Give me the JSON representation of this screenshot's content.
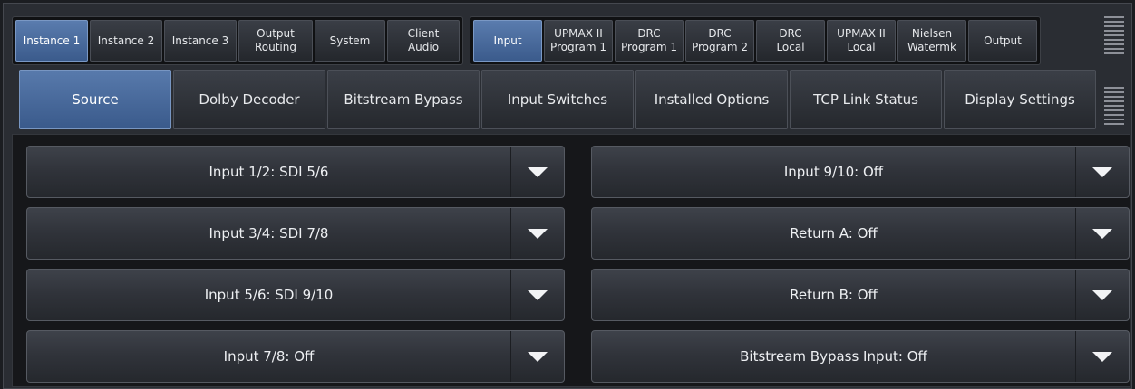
{
  "top_tabs_left": [
    {
      "label": "Instance 1",
      "active": true
    },
    {
      "label": "Instance 2",
      "active": false
    },
    {
      "label": "Instance 3",
      "active": false
    },
    {
      "label": "Output\nRouting",
      "active": false
    },
    {
      "label": "System",
      "active": false
    },
    {
      "label": "Client\nAudio",
      "active": false
    }
  ],
  "top_tabs_right": [
    {
      "label": "Input",
      "active": true
    },
    {
      "label": "UPMAX II\nProgram 1",
      "active": false
    },
    {
      "label": "DRC\nProgram 1",
      "active": false
    },
    {
      "label": "DRC\nProgram 2",
      "active": false
    },
    {
      "label": "DRC\nLocal",
      "active": false
    },
    {
      "label": "UPMAX II\nLocal",
      "active": false
    },
    {
      "label": "Nielsen\nWatermk",
      "active": false
    },
    {
      "label": "Output",
      "active": false
    }
  ],
  "sub_tabs": [
    {
      "label": "Source",
      "active": true
    },
    {
      "label": "Dolby Decoder",
      "active": false
    },
    {
      "label": "Bitstream Bypass",
      "active": false
    },
    {
      "label": "Input Switches",
      "active": false
    },
    {
      "label": "Installed Options",
      "active": false
    },
    {
      "label": "TCP Link Status",
      "active": false
    },
    {
      "label": "Display Settings",
      "active": false
    }
  ],
  "dropdowns_left": [
    "Input 1/2: SDI 5/6",
    "Input 3/4: SDI 7/8",
    "Input 5/6: SDI 9/10",
    "Input 7/8: Off"
  ],
  "dropdowns_right": [
    "Input 9/10: Off",
    "Return A: Off",
    "Return B: Off",
    "Bitstream Bypass Input: Off"
  ],
  "colors": {
    "active_tab": "#4a6b9d",
    "background": "#2a2d33",
    "panel": "#16171a"
  }
}
